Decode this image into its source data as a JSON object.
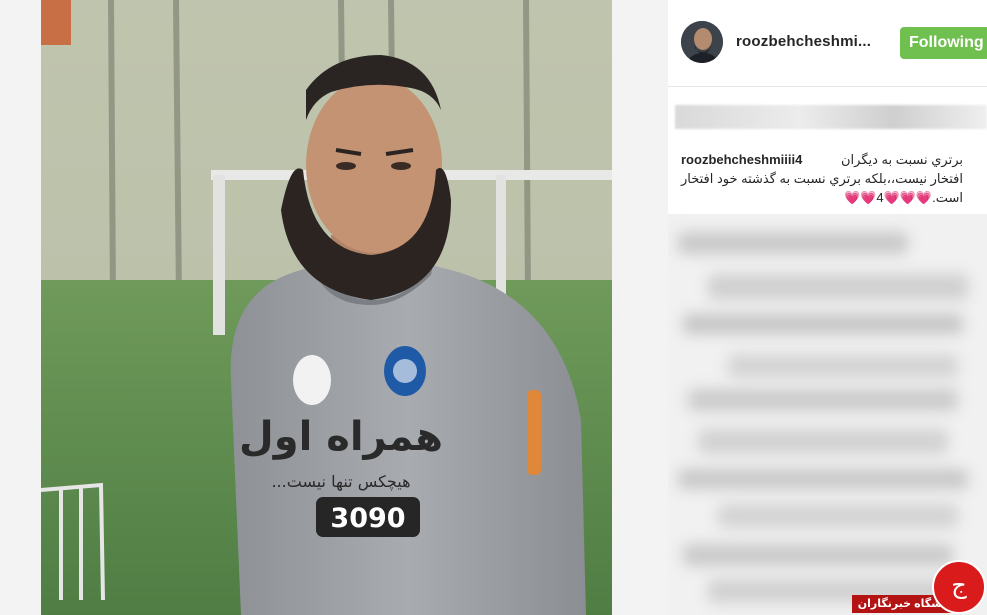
{
  "post": {
    "username": "roozbehcheshmi...",
    "follow_label": "Following",
    "caption_username": "roozbehcheshmiiii4",
    "caption_lines": [
      "برتري نسبت به ديگران",
      "افتخار نيست،،بلكه برتري نسبت به گذشته خود افتخار",
      "است.💗💗💗4💗💗"
    ]
  },
  "photo": {
    "jersey_brand": "همراه اول",
    "jersey_slogan": "هیچکس تنها نیست...",
    "jersey_number": "3090"
  },
  "watermark": {
    "label": "باشگاه خبرنگاران",
    "logo_glyph": "ج"
  },
  "colors": {
    "follow_button": "#70c050",
    "watermark_red": "#b31313",
    "text": "#262626"
  }
}
